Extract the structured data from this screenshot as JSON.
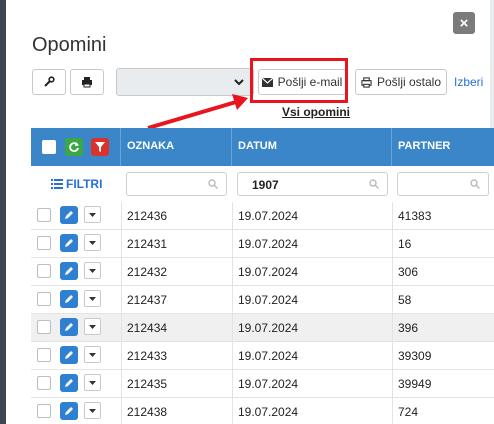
{
  "dialog": {
    "title": "Opomini",
    "close_label": "×",
    "view_title": "Vsi opomini"
  },
  "toolbar": {
    "select_value": "",
    "email_label": "Pošlji e-mail",
    "other_label": "Pošlji ostalo",
    "izberi_label": "Izberi"
  },
  "table": {
    "columns": [
      "OZNAKA",
      "DATUM",
      "PARTNER"
    ],
    "filter_label": "FILTRI",
    "filters": {
      "oznaka": "",
      "datum": "1907",
      "partner": ""
    },
    "rows": [
      {
        "oznaka": "212436",
        "datum": "19.07.2024",
        "partner": "41383"
      },
      {
        "oznaka": "212431",
        "datum": "19.07.2024",
        "partner": "16"
      },
      {
        "oznaka": "212432",
        "datum": "19.07.2024",
        "partner": "306"
      },
      {
        "oznaka": "212437",
        "datum": "19.07.2024",
        "partner": "58"
      },
      {
        "oznaka": "212434",
        "datum": "19.07.2024",
        "partner": "396"
      },
      {
        "oznaka": "212433",
        "datum": "19.07.2024",
        "partner": "39309"
      },
      {
        "oznaka": "212435",
        "datum": "19.07.2024",
        "partner": "39949"
      },
      {
        "oznaka": "212438",
        "datum": "19.07.2024",
        "partner": "724"
      }
    ]
  },
  "colors": {
    "header_bg": "#3b86c9",
    "refresh_green": "#3aa845",
    "filter_red": "#d9342b",
    "annotation_red": "#e8141e",
    "edit_blue": "#2f80d1"
  }
}
